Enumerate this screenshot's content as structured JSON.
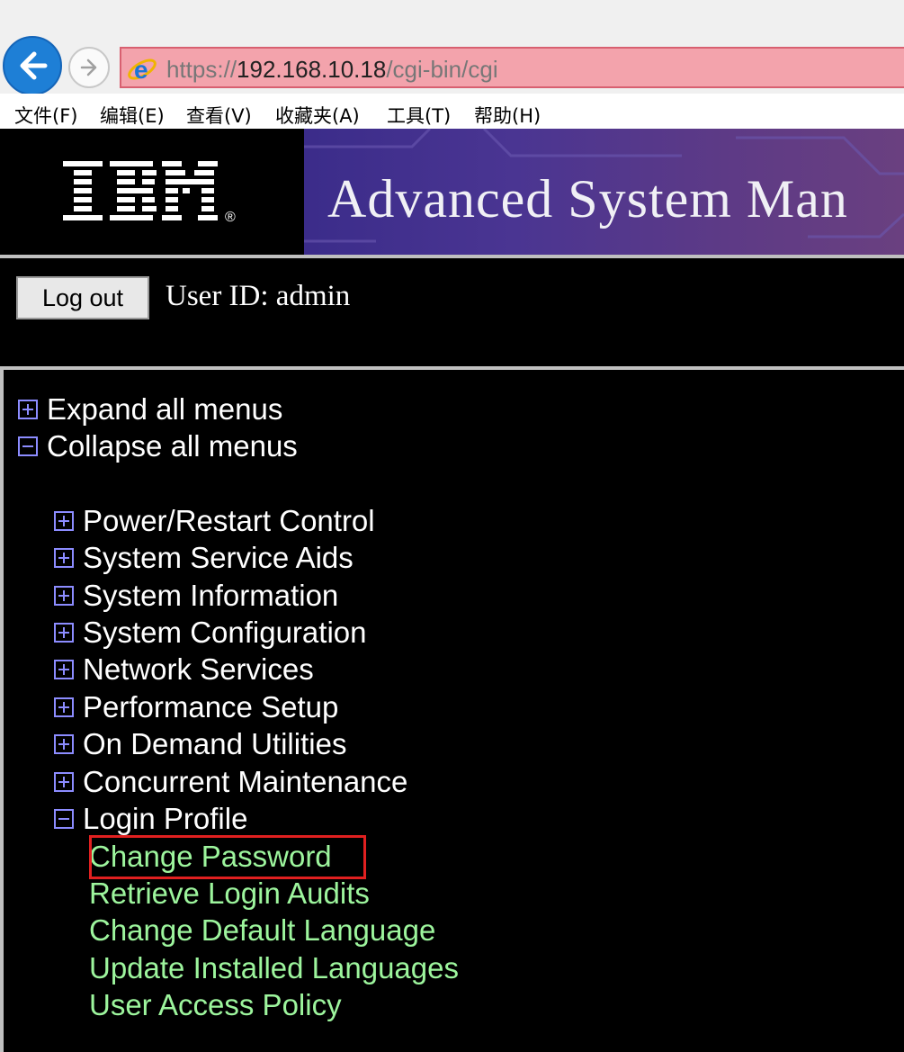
{
  "browser": {
    "url_scheme": "https://",
    "url_host": "192.168.10.18",
    "url_path": "/cgi-bin/cgi",
    "menu": [
      "文件(F)",
      "编辑(E)",
      "查看(V)",
      "收藏夹(A)",
      "工具(T)",
      "帮助(H)"
    ]
  },
  "banner": {
    "logo_text": "IBM",
    "title": "Advanced System Man"
  },
  "userbar": {
    "logout_label": "Log out",
    "user_id_text": "User ID: admin"
  },
  "nav": {
    "expand_all": "Expand all menus",
    "collapse_all": "Collapse all menus",
    "menus": [
      {
        "label": "Power/Restart Control",
        "state": "collapsed"
      },
      {
        "label": "System Service Aids",
        "state": "collapsed"
      },
      {
        "label": "System Information",
        "state": "collapsed"
      },
      {
        "label": "System Configuration",
        "state": "collapsed"
      },
      {
        "label": "Network Services",
        "state": "collapsed"
      },
      {
        "label": "Performance Setup",
        "state": "collapsed"
      },
      {
        "label": "On Demand Utilities",
        "state": "collapsed"
      },
      {
        "label": "Concurrent Maintenance",
        "state": "collapsed"
      },
      {
        "label": "Login Profile",
        "state": "expanded"
      }
    ],
    "login_profile_items": [
      "Change Password",
      "Retrieve Login Audits",
      "Change Default Language",
      "Update Installed Languages",
      "User Access Policy"
    ]
  },
  "colors": {
    "link_green": "#9df59d",
    "expander_blue": "#8c8cff",
    "highlight_red": "#e02020",
    "address_bar_pink": "#f3a3ac"
  }
}
